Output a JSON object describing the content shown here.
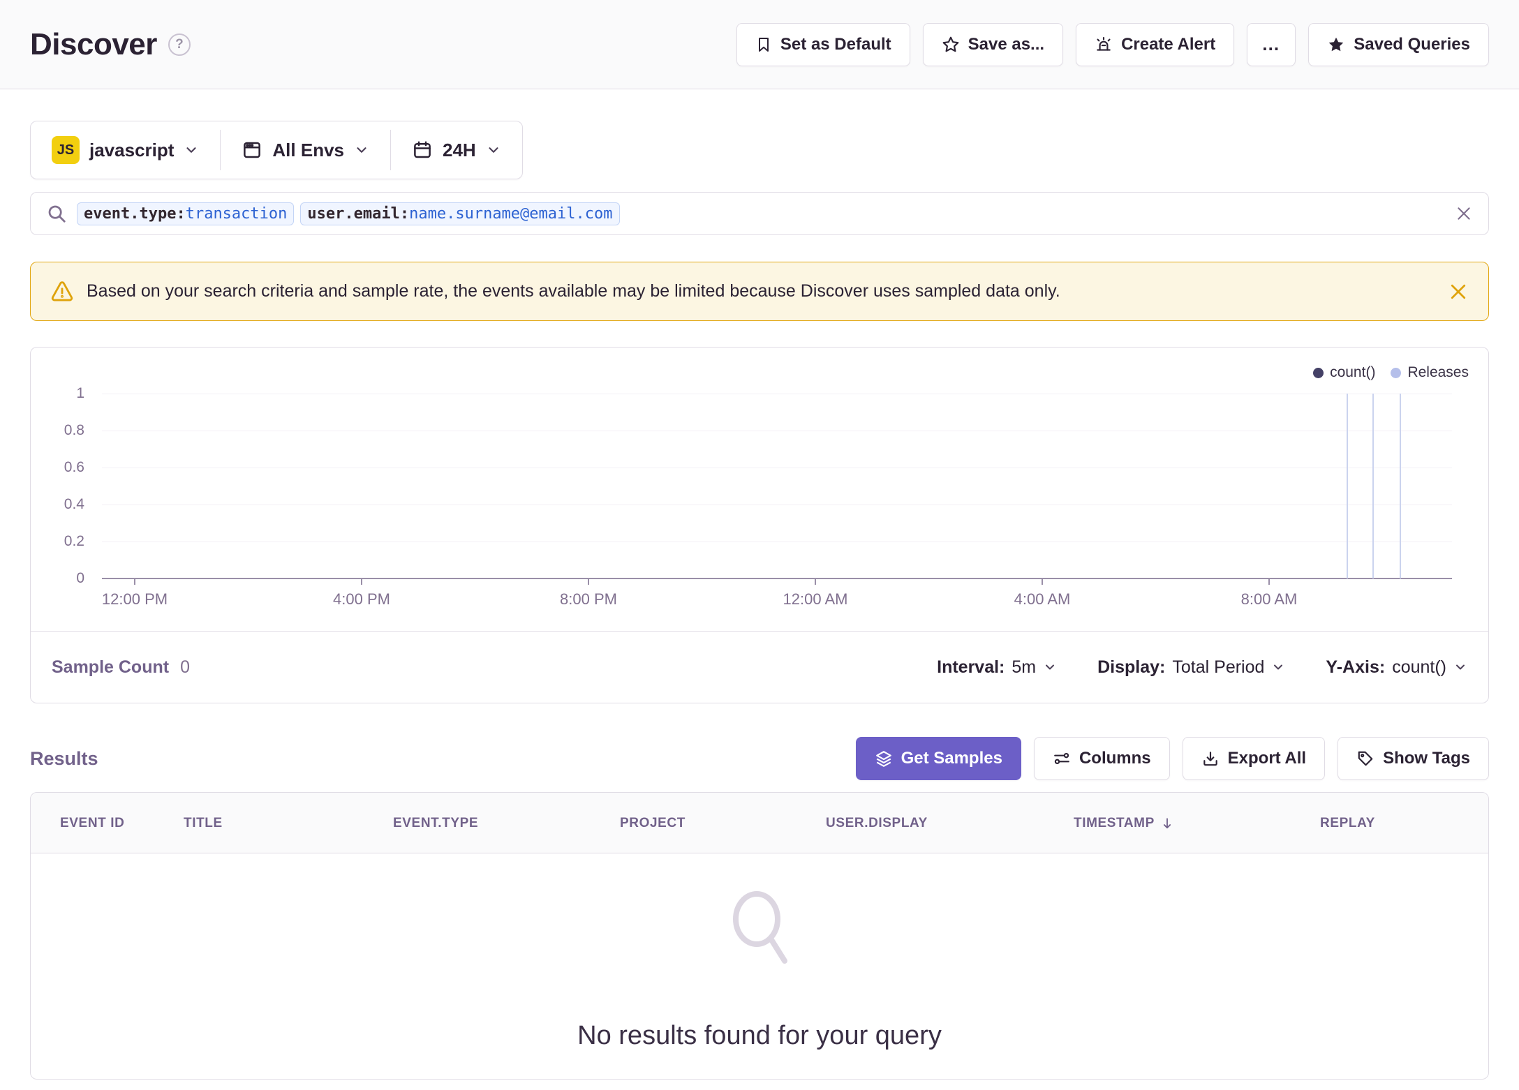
{
  "page": {
    "title": "Discover"
  },
  "header": {
    "buttons": [
      {
        "label": "Set as Default",
        "icon": "bookmark-icon"
      },
      {
        "label": "Save as...",
        "icon": "star-outline-icon"
      },
      {
        "label": "Create Alert",
        "icon": "alert-siren-icon"
      },
      {
        "label": "…",
        "icon": "ellipsis-icon"
      },
      {
        "label": "Saved Queries",
        "icon": "star-filled-icon"
      }
    ]
  },
  "filters": {
    "project": {
      "badge": "JS",
      "label": "javascript"
    },
    "environment": {
      "label": "All Envs"
    },
    "time": {
      "label": "24H"
    }
  },
  "search": {
    "tokens": [
      {
        "key": "event.type:",
        "value": "transaction"
      },
      {
        "key": "user.email:",
        "value": "name.surname@email.com"
      }
    ]
  },
  "banner": {
    "text": "Based on your search criteria and sample rate, the events available may be limited because Discover uses sampled data only."
  },
  "chart": {
    "legend": [
      {
        "label": "count()",
        "color": "#444066"
      },
      {
        "label": "Releases",
        "color": "#B5BFEA"
      }
    ],
    "y_ticks": [
      "1",
      "0.8",
      "0.6",
      "0.4",
      "0.2",
      "0"
    ],
    "x_ticks": [
      "12:00 PM",
      "4:00 PM",
      "8:00 PM",
      "12:00 AM",
      "4:00 AM",
      "8:00 AM"
    ],
    "releases_x_pct": [
      92.2,
      94.1,
      96.1
    ]
  },
  "chart_data": {
    "type": "line",
    "title": "",
    "xlabel": "",
    "ylabel": "",
    "ylim": [
      0,
      1
    ],
    "x": [
      "12:00 PM",
      "4:00 PM",
      "8:00 PM",
      "12:00 AM",
      "4:00 AM",
      "8:00 AM"
    ],
    "series": [
      {
        "name": "count()",
        "values": [
          0,
          0,
          0,
          0,
          0,
          0
        ]
      }
    ],
    "annotations": {
      "release_markers_x_pct": [
        92.2,
        94.1,
        96.1
      ]
    },
    "legend_position": "top-right",
    "grid": true
  },
  "chart_footer": {
    "sample_count_label": "Sample Count",
    "sample_count_value": "0",
    "controls": [
      {
        "label": "Interval:",
        "value": "5m"
      },
      {
        "label": "Display:",
        "value": "Total Period"
      },
      {
        "label": "Y-Axis:",
        "value": "count()"
      }
    ]
  },
  "results": {
    "title": "Results",
    "buttons": [
      {
        "label": "Get Samples",
        "icon": "layers-icon",
        "style": "primary"
      },
      {
        "label": "Columns",
        "icon": "sliders-icon",
        "style": "default"
      },
      {
        "label": "Export All",
        "icon": "download-icon",
        "style": "default"
      },
      {
        "label": "Show Tags",
        "icon": "tag-icon",
        "style": "default"
      }
    ]
  },
  "table": {
    "columns": [
      "EVENT ID",
      "TITLE",
      "EVENT.TYPE",
      "PROJECT",
      "USER.DISPLAY",
      "TIMESTAMP",
      "REPLAY"
    ],
    "sort": {
      "column": "TIMESTAMP",
      "direction": "desc"
    },
    "rows": [],
    "empty_text": "No results found for your query"
  },
  "colors": {
    "accent_purple": "#6C5FC7",
    "text_dark": "#2B2233",
    "text_muted": "#80708F",
    "border": "#E0DCE5",
    "token_blue": "#2D62D2",
    "warning_border": "#E2A713",
    "warning_bg": "#FCF6E2",
    "js_yellow": "#F2CF0F",
    "release_line": "#CBD3EE"
  }
}
